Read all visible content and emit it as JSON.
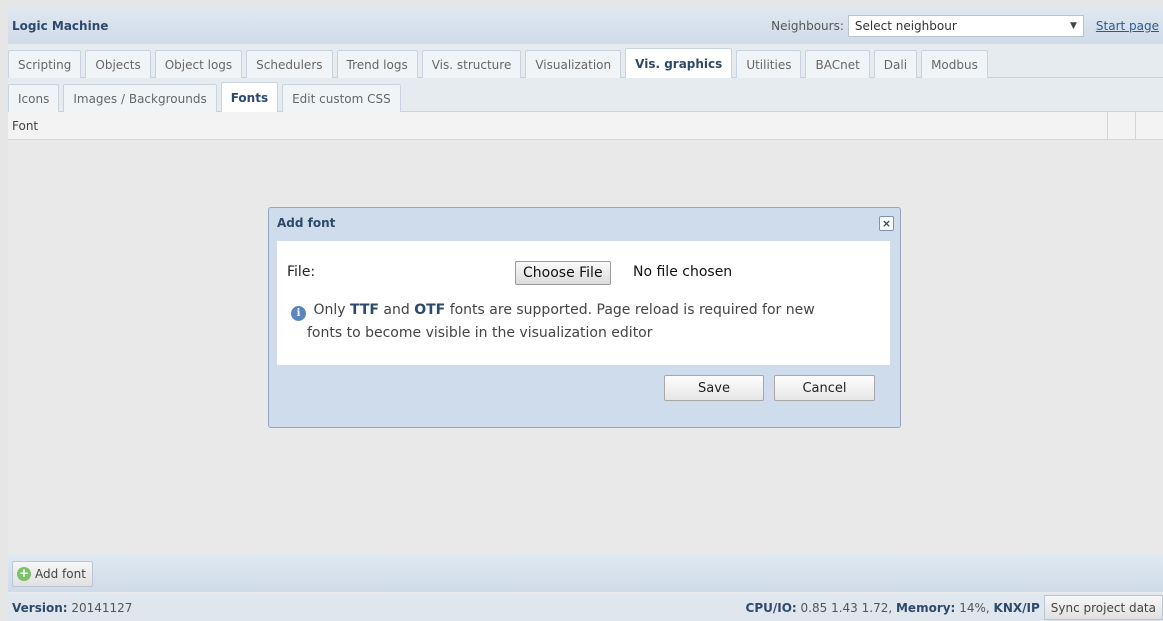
{
  "header": {
    "title": "Logic Machine",
    "neighbours_label": "Neighbours:",
    "neighbour_select": "Select neighbour",
    "start_page": "Start page"
  },
  "tabs": [
    {
      "label": "Scripting"
    },
    {
      "label": "Objects"
    },
    {
      "label": "Object logs"
    },
    {
      "label": "Schedulers"
    },
    {
      "label": "Trend logs"
    },
    {
      "label": "Vis. structure"
    },
    {
      "label": "Visualization"
    },
    {
      "label": "Vis. graphics",
      "active": true
    },
    {
      "label": "Utilities"
    },
    {
      "label": "BACnet"
    },
    {
      "label": "Dali"
    },
    {
      "label": "Modbus"
    }
  ],
  "subtabs": [
    {
      "label": "Icons"
    },
    {
      "label": "Images / Backgrounds"
    },
    {
      "label": "Fonts",
      "active": true
    },
    {
      "label": "Edit custom CSS"
    }
  ],
  "table": {
    "col_font": "Font"
  },
  "dialog": {
    "title": "Add font",
    "close": "×",
    "file_label": "File:",
    "choose_button": "Choose File",
    "no_file": "No file chosen",
    "info_pre": "Only",
    "info_ttf": "TTF",
    "info_and": "and",
    "info_otf": "OTF",
    "info_post": "fonts are supported. Page reload is required for new",
    "info_line2": "fonts to become visible in the visualization editor",
    "save": "Save",
    "cancel": "Cancel"
  },
  "bottom": {
    "add_font": "Add font"
  },
  "status": {
    "version_label": "Version:",
    "version": "20141127",
    "cpu_label": "CPU/IO:",
    "cpu": "0.85 1.43 1.72,",
    "memory_label": "Memory:",
    "memory": "14%,",
    "knx": "KNX/IP",
    "sync": "Sync project data"
  },
  "colors": {
    "accent": "#2d4a6b",
    "dialog_bg": "#cfdceb",
    "add_icon": "#7cc06a",
    "info_icon": "#5a86c0"
  }
}
